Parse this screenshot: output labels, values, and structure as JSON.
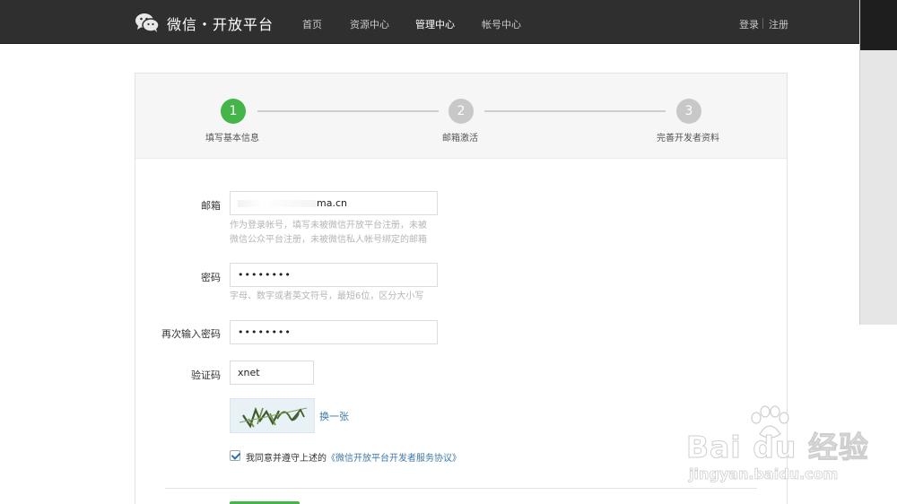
{
  "header": {
    "logo_text": "微信・开放平台",
    "nav": [
      "首页",
      "资源中心",
      "管理中心",
      "帐号中心"
    ],
    "active_nav": "管理中心",
    "login": "登录",
    "register": "注册"
  },
  "steps": [
    {
      "number": "1",
      "label": "填写基本信息",
      "active": true
    },
    {
      "number": "2",
      "label": "邮箱激活",
      "active": false
    },
    {
      "number": "3",
      "label": "完善开发者资料",
      "active": false
    }
  ],
  "form": {
    "email": {
      "label": "邮箱",
      "value": "ma.cn",
      "hint_line1": "作为登录帐号，填写未被微信开放平台注册，未被",
      "hint_line2": "微信公众平台注册，未被微信私人帐号绑定的邮箱"
    },
    "password": {
      "label": "密码",
      "value": "••••••••",
      "hint": "字母、数字或者英文符号，最短6位，区分大小写"
    },
    "confirm_password": {
      "label": "再次输入密码",
      "value": "••••••••"
    },
    "captcha": {
      "label": "验证码",
      "value": "xnet",
      "refresh_link": "换一张"
    },
    "agreement": {
      "checked": true,
      "text": "我同意并遵守上述的",
      "link": "《微信开放平台开发者服务协议》"
    }
  },
  "watermark": {
    "brand": "Bai du 经验",
    "url": "jingyan.baidu.com"
  },
  "colors": {
    "header_bg": "#2f2f2f",
    "accent_green": "#44b549",
    "link_blue": "#3b77a8"
  }
}
